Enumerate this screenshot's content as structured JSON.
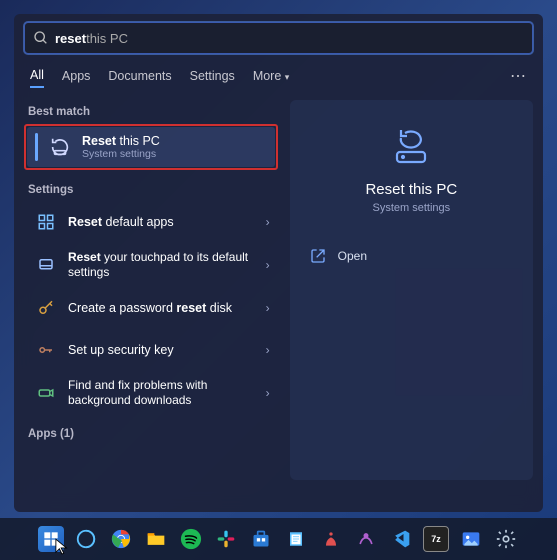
{
  "search": {
    "bold": "reset",
    "rest": " this PC"
  },
  "tabs": {
    "all": "All",
    "apps": "Apps",
    "documents": "Documents",
    "settings": "Settings",
    "more": "More"
  },
  "sections": {
    "best_match": "Best match",
    "settings": "Settings",
    "apps": "Apps (1)"
  },
  "hero": {
    "title_bold": "Reset",
    "title_rest": " this PC",
    "sub": "System settings"
  },
  "items": [
    {
      "pre": "",
      "bold": "Reset",
      "post": " default apps"
    },
    {
      "pre": "",
      "bold": "Reset",
      "post": " your touchpad to its default settings"
    },
    {
      "pre": "Create a password ",
      "bold": "reset",
      "post": " disk"
    },
    {
      "pre": "Set up security key",
      "bold": "",
      "post": ""
    },
    {
      "pre": "Find and fix problems with background downloads",
      "bold": "",
      "post": ""
    }
  ],
  "preview": {
    "title": "Reset this PC",
    "sub": "System settings",
    "open": "Open"
  }
}
